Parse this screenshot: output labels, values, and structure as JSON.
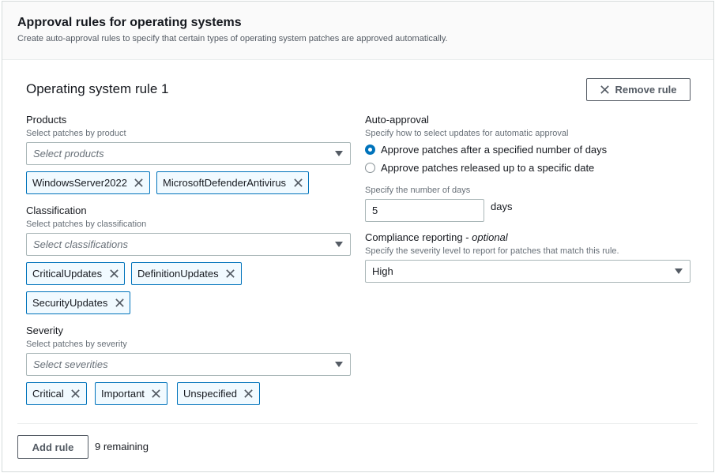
{
  "panel": {
    "title": "Approval rules for operating systems",
    "description": "Create auto-approval rules to specify that certain types of operating system patches are approved automatically."
  },
  "rule": {
    "title": "Operating system rule 1",
    "remove_label": "Remove rule"
  },
  "products": {
    "label": "Products",
    "description": "Select patches by product",
    "placeholder": "Select products",
    "tokens": [
      "WindowsServer2022",
      "MicrosoftDefenderAntivirus"
    ]
  },
  "classification": {
    "label": "Classification",
    "description": "Select patches by classification",
    "placeholder": "Select classifications",
    "tokens": [
      "CriticalUpdates",
      "DefinitionUpdates",
      "SecurityUpdates"
    ]
  },
  "severity": {
    "label": "Severity",
    "description": "Select patches by severity",
    "placeholder": "Select severities",
    "tokens": [
      "Critical",
      "Important",
      "Unspecified"
    ]
  },
  "auto_approval": {
    "label": "Auto-approval",
    "description": "Specify how to select updates for automatic approval",
    "options": [
      {
        "label": "Approve patches after a specified number of days",
        "checked": true
      },
      {
        "label": "Approve patches released up to a specific date",
        "checked": false
      }
    ],
    "days_label": "Specify the number of days",
    "days_value": "5",
    "days_unit": "days"
  },
  "compliance": {
    "label": "Compliance reporting",
    "optional": "optional",
    "separator": " - ",
    "description": "Specify the severity level to report for patches that match this rule.",
    "value": "High"
  },
  "footer": {
    "add_label": "Add rule",
    "remaining": "9 remaining"
  },
  "colors": {
    "accent": "#0073bb",
    "token_bg": "#f1faff",
    "border": "#aab7b8"
  },
  "icons": {
    "remove": "close-icon",
    "dismiss": "close-icon",
    "caret": "caret-down-icon"
  }
}
